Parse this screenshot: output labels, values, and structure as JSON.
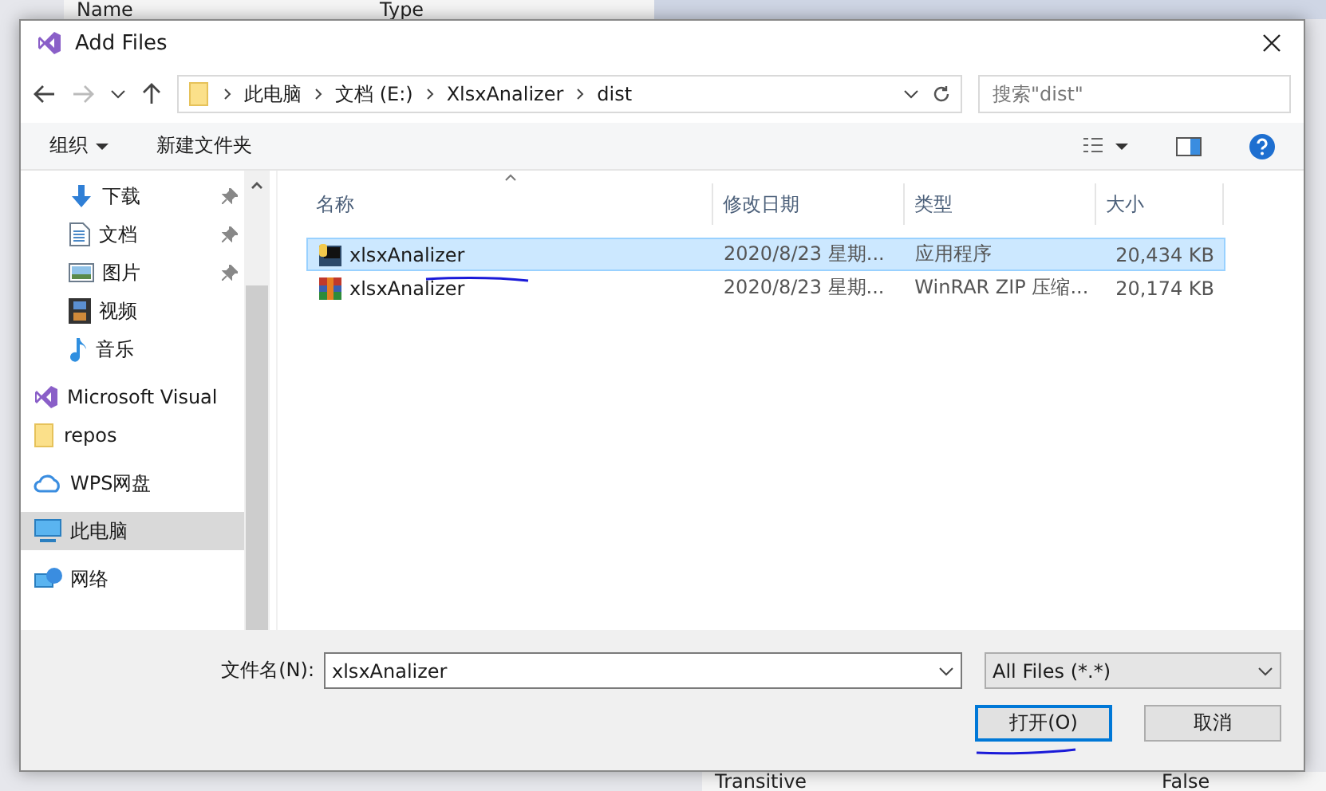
{
  "background": {
    "header": [
      "Name",
      "Type"
    ],
    "row": [
      "Transitive",
      "False"
    ]
  },
  "window": {
    "title": "Add Files"
  },
  "breadcrumb": [
    "此电脑",
    "文档 (E:)",
    "XlsxAnalizer",
    "dist"
  ],
  "search": {
    "placeholder": "搜索\"dist\""
  },
  "toolbar": {
    "organize": "组织",
    "new_folder": "新建文件夹"
  },
  "sidebar": {
    "sections": [
      {
        "items": [
          {
            "label": "下载",
            "kind": "download",
            "pinned": true,
            "selected": false
          },
          {
            "label": "文档",
            "kind": "document",
            "pinned": true,
            "selected": false
          },
          {
            "label": "图片",
            "kind": "image",
            "pinned": true,
            "selected": false
          },
          {
            "label": "视频",
            "kind": "video",
            "pinned": false,
            "selected": false
          },
          {
            "label": "音乐",
            "kind": "music",
            "pinned": false,
            "selected": false
          }
        ]
      },
      {
        "items": [
          {
            "label": "Microsoft Visual",
            "kind": "vs",
            "pinned": false,
            "selected": false
          },
          {
            "label": "repos",
            "kind": "folder",
            "pinned": false,
            "selected": false
          }
        ]
      },
      {
        "items": [
          {
            "label": "WPS网盘",
            "kind": "cloud",
            "pinned": false,
            "selected": false
          }
        ]
      },
      {
        "items": [
          {
            "label": "此电脑",
            "kind": "pc",
            "pinned": false,
            "selected": true
          }
        ]
      },
      {
        "items": [
          {
            "label": "网络",
            "kind": "network",
            "pinned": false,
            "selected": false
          }
        ]
      }
    ]
  },
  "table": {
    "columns": [
      "名称",
      "修改日期",
      "类型",
      "大小"
    ],
    "rows": [
      {
        "name": "xlsxAnalizer",
        "kind": "app",
        "date": "2020/8/23 星期...",
        "type": "应用程序",
        "size": "20,434 KB",
        "selected": true
      },
      {
        "name": "xlsxAnalizer",
        "kind": "archive",
        "date": "2020/8/23 星期...",
        "type": "WinRAR ZIP 压缩...",
        "size": "20,174 KB",
        "selected": false
      }
    ]
  },
  "filename": {
    "label": "文件名(N):",
    "value": "xlsxAnalizer"
  },
  "filter": {
    "value": "All Files (*.*)"
  },
  "buttons": [
    {
      "label": "打开(O)",
      "default": true
    },
    {
      "label": "取消",
      "default": false
    }
  ]
}
